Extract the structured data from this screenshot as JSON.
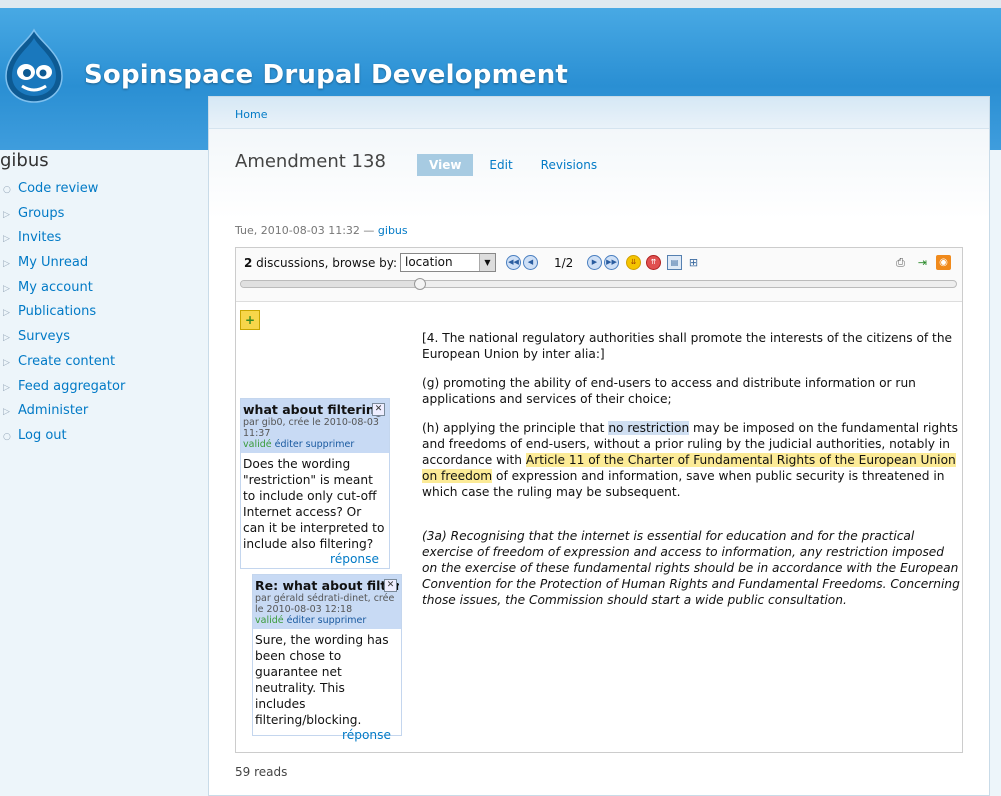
{
  "site": {
    "name": "Sopinspace Drupal Development"
  },
  "sidebar": {
    "title": "gibus",
    "items": [
      {
        "label": "Code review",
        "bullet": "○"
      },
      {
        "label": "Groups",
        "bullet": "▷"
      },
      {
        "label": "Invites",
        "bullet": "▷"
      },
      {
        "label": "My Unread",
        "bullet": "▷"
      },
      {
        "label": "My account",
        "bullet": "▷"
      },
      {
        "label": "Publications",
        "bullet": "▷"
      },
      {
        "label": "Surveys",
        "bullet": "▷"
      },
      {
        "label": "Create content",
        "bullet": "▷"
      },
      {
        "label": "Feed aggregator",
        "bullet": "▷"
      },
      {
        "label": "Administer",
        "bullet": "▷"
      },
      {
        "label": "Log out",
        "bullet": "○"
      }
    ]
  },
  "breadcrumb": "Home",
  "page": {
    "title": "Amendment 138",
    "tabs": [
      {
        "label": "View",
        "active": true
      },
      {
        "label": "Edit",
        "active": false
      },
      {
        "label": "Revisions",
        "active": false
      }
    ],
    "submitted_date": "Tue, 2010-08-03 11:32 — ",
    "submitted_author": "gibus",
    "reads": "59 reads"
  },
  "toolbar": {
    "count": "2",
    "count_suffix": " discussions, browse by:",
    "browse_value": "location",
    "counter": "1/2",
    "slider_position": 0.25
  },
  "text": {
    "p1": "[4. The national regulatory authorities shall promote the interests of the citizens of the European Union by inter alia:]",
    "p2": "(g) promoting the ability of end-users to access and distribute information or run applications and services of their choice;",
    "p3_a": "(h) applying the principle that ",
    "p3_hl1": "no restriction",
    "p3_b": " may be imposed on the fundamental rights and freedoms of end-users, without a prior ruling by the judicial authorities, notably in accordance with ",
    "p3_hl2": "Article 11 of the Charter of Fundamental Rights of the European Union on freedom",
    "p3_c": " of expression and information, save when public security is threatened in which case the ruling may be subsequent.",
    "p4": "(3a) Recognising that the internet is essential for education and for the practical exercise of freedom of expression and access to information, any restriction imposed on the exercise of these fundamental rights should be in accordance with the European Convention for the Protection of Human Rights and Fundamental Freedoms. Concerning those issues, the Commission should start a wide public consultation."
  },
  "comments": [
    {
      "title": "what about filtering",
      "meta": "par gib0, crée le 2010-08-03 11:37",
      "status": "validé",
      "edit": "éditer",
      "delete": "supprimer",
      "body": "Does the wording \"restriction\" is meant to include only cut-off Internet access? Or can it be interpreted to include also filtering?",
      "reply": "réponse"
    },
    {
      "title": "Re: what about filteri",
      "meta": "par gérald sédrati-dinet, crée le 2010-08-03 12:18",
      "status": "validé",
      "edit": "éditer",
      "delete": "supprimer",
      "body": "Sure, the wording has been chose to guarantee net neutrality. This includes filtering/blocking.",
      "reply": "réponse"
    }
  ],
  "colors": {
    "brand": "#2a8fd3",
    "link": "#027ac6",
    "highlight_blue": "#d0dff2",
    "highlight_yellow": "#fceb97"
  }
}
